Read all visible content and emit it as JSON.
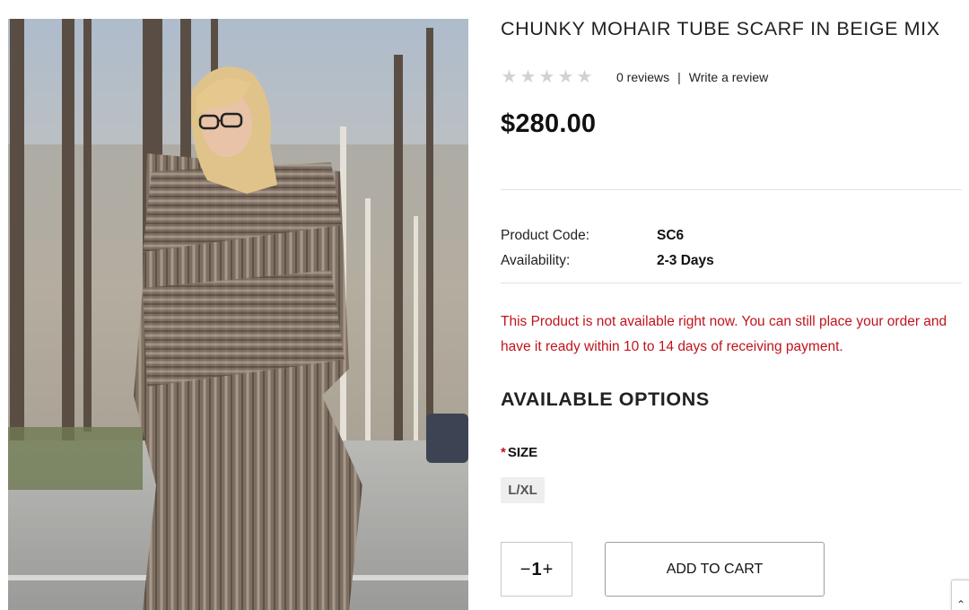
{
  "product": {
    "title": "CHUNKY MOHAIR TUBE SCARF IN BEIGE MIX",
    "image_alt": "Woman wrapped in chunky knitted mohair tube scarf outdoors",
    "rating": {
      "stars": 0,
      "max_stars": 5,
      "reviews_label": "0 reviews",
      "separator": "|",
      "write_review_label": "Write a review"
    },
    "price": "$280.00",
    "specs": [
      {
        "label": "Product Code:",
        "value": "SC6"
      },
      {
        "label": "Availability:",
        "value": "2-3 Days"
      }
    ],
    "notice": "This Product is not available right now. You can still place your order and have it ready within 10 to 14 days of receiving payment."
  },
  "options": {
    "heading": "AVAILABLE OPTIONS",
    "size": {
      "required_mark": "*",
      "label": "SIZE",
      "choices": [
        "L/XL"
      ]
    }
  },
  "purchase": {
    "decrement": "−",
    "quantity": "1",
    "increment": "+",
    "add_to_cart_label": "ADD TO CART"
  },
  "icons": {
    "star": "star-icon",
    "corner": "scroll-top-icon"
  },
  "colors": {
    "notice_red": "#c0141c",
    "star_empty": "#d2d2d2",
    "chip_bg": "#eeeeee"
  }
}
